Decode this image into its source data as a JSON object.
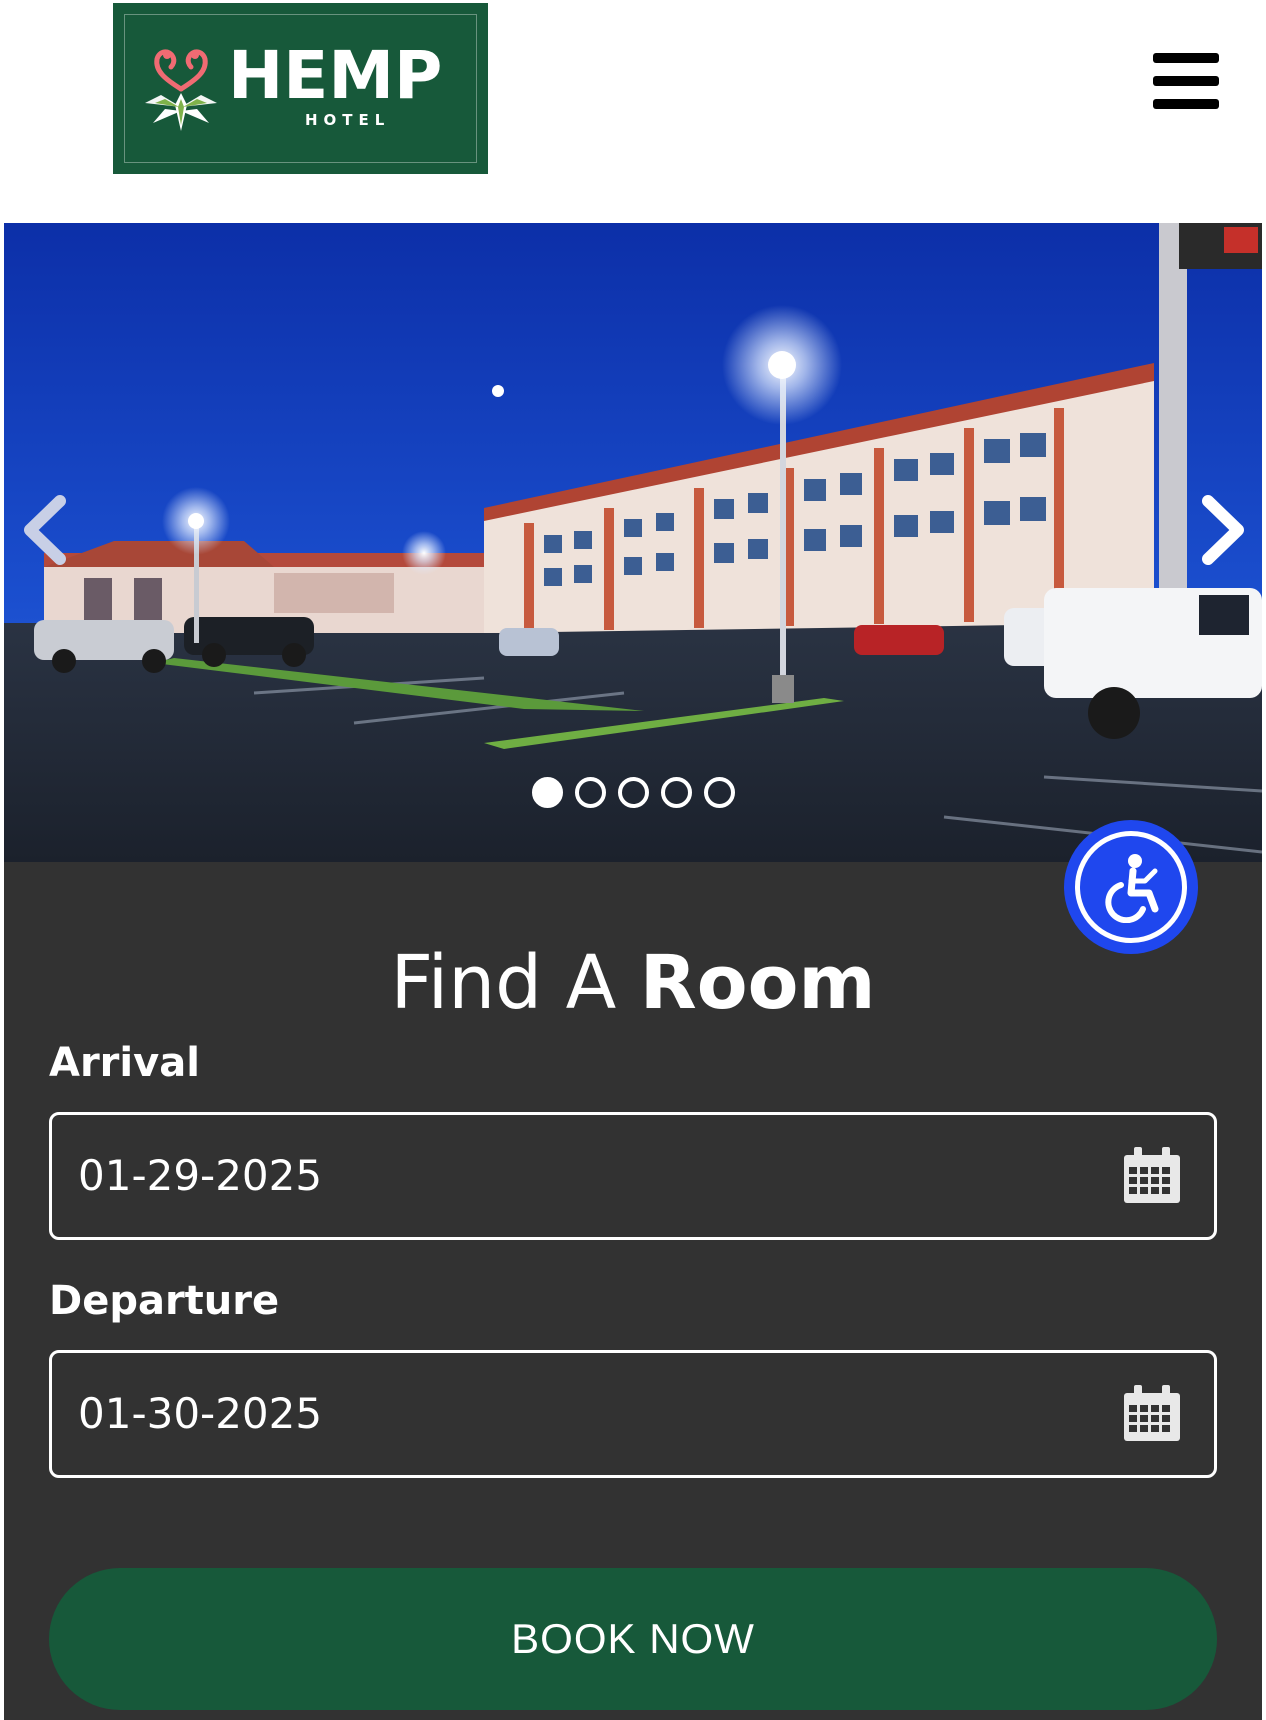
{
  "header": {
    "logo_word": "HEMP",
    "logo_sub": "HOTEL",
    "brand_color": "#17593a",
    "menu_icon": "hamburger-menu-icon"
  },
  "hero": {
    "image_description": "Hotel exterior at dusk",
    "prev_icon": "chevron-left-icon",
    "next_icon": "chevron-right-icon",
    "slide_count": 5,
    "active_slide": 1
  },
  "booking": {
    "title_light": "Find A ",
    "title_bold": "Room",
    "arrival": {
      "label": "Arrival",
      "value": "01-29-2025",
      "icon": "calendar-icon"
    },
    "departure": {
      "label": "Departure",
      "value": "01-30-2025",
      "icon": "calendar-icon"
    },
    "book_label": "BOOK NOW",
    "panel_color": "#323232"
  },
  "accessibility": {
    "icon": "wheelchair-accessibility-icon",
    "color": "#1f47ee"
  }
}
